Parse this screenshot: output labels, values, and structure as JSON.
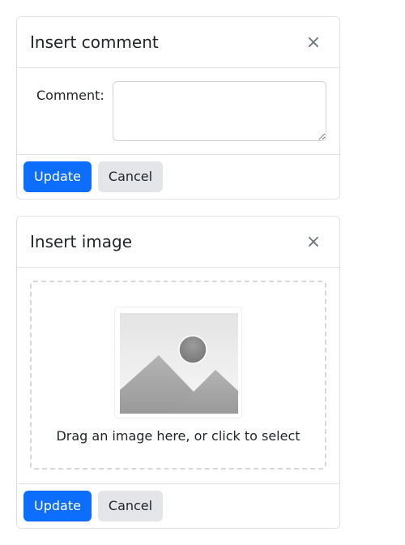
{
  "comment_dialog": {
    "title": "Insert comment",
    "close_symbol": "×",
    "comment_label": "Comment:",
    "comment_value": "",
    "update_label": "Update",
    "cancel_label": "Cancel"
  },
  "image_dialog": {
    "title": "Insert image",
    "close_symbol": "×",
    "drop_text": "Drag an image here, or click to select",
    "placeholder_icon": "image-placeholder-icon",
    "update_label": "Update",
    "cancel_label": "Cancel"
  },
  "colors": {
    "primary": "#0d6efd",
    "secondary": "#e3e5e8",
    "border": "#dee2e6"
  }
}
